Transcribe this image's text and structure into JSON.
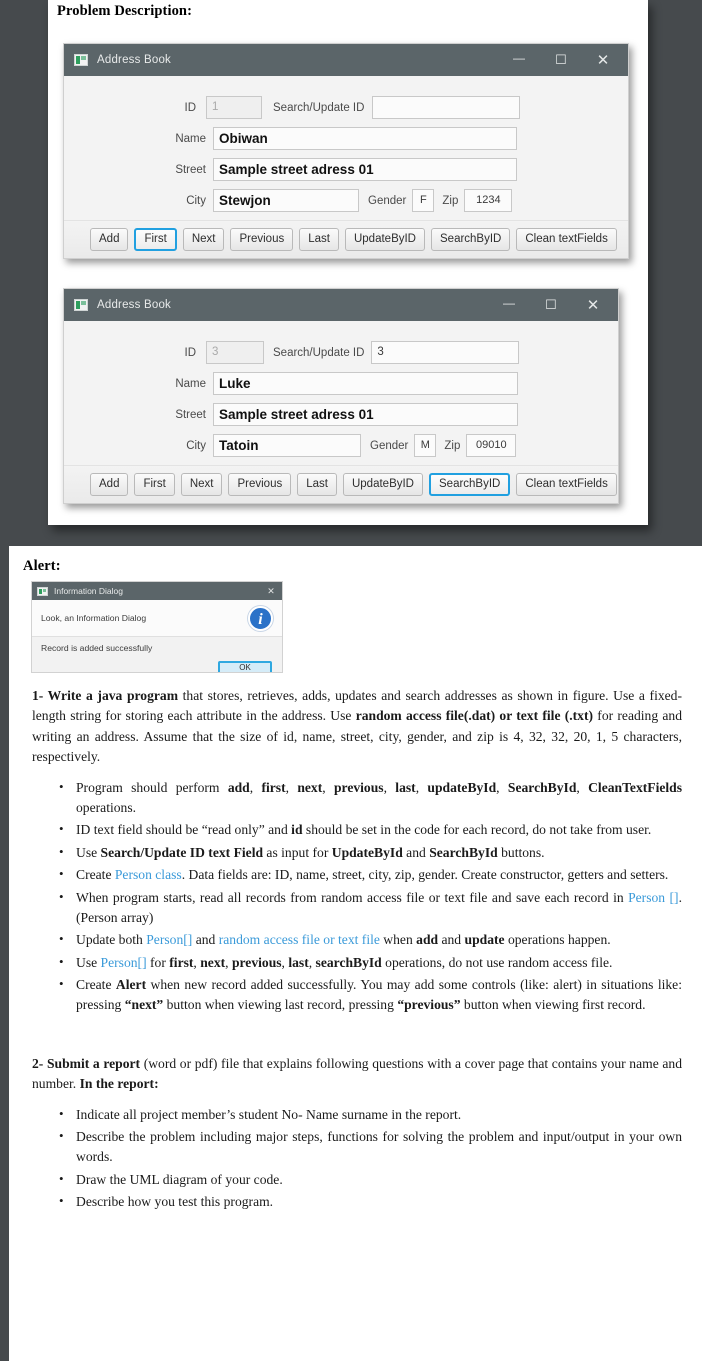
{
  "page": {
    "background_color": "#464a4d",
    "paper_color": "#ffffff"
  },
  "sections": {
    "problem_heading": "Problem Description:",
    "alert_heading": "Alert:"
  },
  "windows": [
    {
      "title": "Address Book",
      "icon": "app-window-icon",
      "titlebar_color": "#5b6569",
      "controls": {
        "minimize": "—",
        "maximize": "☐",
        "close": "✕"
      },
      "fields": {
        "id_label": "ID",
        "id_value": "1",
        "id_readonly": true,
        "search_update_label": "Search/Update ID",
        "search_update_value": "",
        "name_label": "Name",
        "name_value": "Obiwan",
        "street_label": "Street",
        "street_value": "Sample street adress 01",
        "city_label": "City",
        "city_value": "Stewjon",
        "gender_label": "Gender",
        "gender_value": "F",
        "zip_label": "Zip",
        "zip_value": "1234"
      },
      "buttons": [
        {
          "label": "Add",
          "focused": false
        },
        {
          "label": "First",
          "focused": true
        },
        {
          "label": "Next",
          "focused": false
        },
        {
          "label": "Previous",
          "focused": false
        },
        {
          "label": "Last",
          "focused": false
        },
        {
          "label": "UpdateByID",
          "focused": false
        },
        {
          "label": "SearchByID",
          "focused": false
        },
        {
          "label": "Clean textFields",
          "focused": false
        }
      ]
    },
    {
      "title": "Address Book",
      "icon": "app-window-icon",
      "titlebar_color": "#5b6569",
      "controls": {
        "minimize": "—",
        "maximize": "☐",
        "close": "✕"
      },
      "fields": {
        "id_label": "ID",
        "id_value": "3",
        "id_readonly": true,
        "search_update_label": "Search/Update ID",
        "search_update_value": "3",
        "name_label": "Name",
        "name_value": "Luke",
        "street_label": "Street",
        "street_value": "Sample street adress 01",
        "city_label": "City",
        "city_value": "Tatoin",
        "gender_label": "Gender",
        "gender_value": "M",
        "zip_label": "Zip",
        "zip_value": "09010"
      },
      "buttons": [
        {
          "label": "Add",
          "focused": false
        },
        {
          "label": "First",
          "focused": false
        },
        {
          "label": "Next",
          "focused": false
        },
        {
          "label": "Previous",
          "focused": false
        },
        {
          "label": "Last",
          "focused": false
        },
        {
          "label": "UpdateByID",
          "focused": false
        },
        {
          "label": "SearchByID",
          "focused": true
        },
        {
          "label": "Clean textFields",
          "focused": false
        }
      ]
    }
  ],
  "dialog": {
    "title": "Information Dialog",
    "close_glyph": "✕",
    "header_text": "Look, an Information Dialog",
    "icon_glyph": "i",
    "icon_color": "#2b72c8",
    "message": "Record is added successfully",
    "ok_label": "OK",
    "ok_accent": "#2fa8e0"
  },
  "document": {
    "task1": {
      "number_bold": "1- Write a java program",
      "text_a": " that stores, retrieves, adds, updates and search addresses as shown in figure. Use a fixed-length string for storing each attribute in the address. Use ",
      "bold_b": "random access file(.dat) or text file (.txt)",
      "text_c": " for reading and writing an address. Assume that the size of id, name, street, city, gender, and zip is 4, 32, 32, 20, 1, 5 characters, respectively.",
      "bullets": [
        {
          "parts": [
            {
              "t": "Program should perform ",
              "s": "normal"
            },
            {
              "t": "add",
              "s": "bold"
            },
            {
              "t": ", ",
              "s": "normal"
            },
            {
              "t": "first",
              "s": "bold"
            },
            {
              "t": ", ",
              "s": "normal"
            },
            {
              "t": "next",
              "s": "bold"
            },
            {
              "t": ", ",
              "s": "normal"
            },
            {
              "t": "previous",
              "s": "bold"
            },
            {
              "t": ", ",
              "s": "normal"
            },
            {
              "t": "last",
              "s": "bold"
            },
            {
              "t": ", ",
              "s": "normal"
            },
            {
              "t": "updateById",
              "s": "bold"
            },
            {
              "t": ", ",
              "s": "normal"
            },
            {
              "t": "SearchById",
              "s": "bold"
            },
            {
              "t": ", ",
              "s": "normal"
            },
            {
              "t": "CleanTextFields",
              "s": "bold"
            },
            {
              "t": " operations.",
              "s": "normal"
            }
          ]
        },
        {
          "parts": [
            {
              "t": "ID text field should be “read only” and ",
              "s": "normal"
            },
            {
              "t": "id",
              "s": "bold"
            },
            {
              "t": " should be set in the code for each record, do not take from user.",
              "s": "normal"
            }
          ]
        },
        {
          "parts": [
            {
              "t": "Use ",
              "s": "normal"
            },
            {
              "t": "Search/Update ID text Field",
              "s": "bold"
            },
            {
              "t": " as input for ",
              "s": "normal"
            },
            {
              "t": "UpdateById",
              "s": "bold"
            },
            {
              "t": " and ",
              "s": "normal"
            },
            {
              "t": "SearchById",
              "s": "bold"
            },
            {
              "t": " buttons.",
              "s": "normal"
            }
          ]
        },
        {
          "parts": [
            {
              "t": "Create ",
              "s": "normal"
            },
            {
              "t": "Person class",
              "s": "blue"
            },
            {
              "t": ". Data fields are: ID, name, street, city, zip, gender. Create constructor, getters and setters.",
              "s": "normal"
            }
          ]
        },
        {
          "parts": [
            {
              "t": "When program starts, read all records from random access file or text file and save each record in ",
              "s": "normal"
            },
            {
              "t": "Person []",
              "s": "blue"
            },
            {
              "t": ". (Person array)",
              "s": "normal"
            }
          ]
        },
        {
          "parts": [
            {
              "t": "Update both ",
              "s": "normal"
            },
            {
              "t": "Person[]",
              "s": "blue"
            },
            {
              "t": " and ",
              "s": "normal"
            },
            {
              "t": "random access file or text file",
              "s": "blue"
            },
            {
              "t": " when ",
              "s": "normal"
            },
            {
              "t": "add",
              "s": "bold"
            },
            {
              "t": " and ",
              "s": "normal"
            },
            {
              "t": "update",
              "s": "bold"
            },
            {
              "t": " operations happen.",
              "s": "normal"
            }
          ]
        },
        {
          "parts": [
            {
              "t": "Use ",
              "s": "normal"
            },
            {
              "t": "Person[]",
              "s": "blue"
            },
            {
              "t": " for ",
              "s": "normal"
            },
            {
              "t": "first",
              "s": "bold"
            },
            {
              "t": ", ",
              "s": "normal"
            },
            {
              "t": "next",
              "s": "bold"
            },
            {
              "t": ", ",
              "s": "normal"
            },
            {
              "t": "previous",
              "s": "bold"
            },
            {
              "t": ", ",
              "s": "normal"
            },
            {
              "t": "last",
              "s": "bold"
            },
            {
              "t": ", ",
              "s": "normal"
            },
            {
              "t": "searchById",
              "s": "bold"
            },
            {
              "t": " operations, do not use random access file.",
              "s": "normal"
            }
          ]
        },
        {
          "parts": [
            {
              "t": "Create ",
              "s": "normal"
            },
            {
              "t": "Alert",
              "s": "bold"
            },
            {
              "t": " when new record added successfully. You may add some controls (like: alert) in situations like: pressing ",
              "s": "normal"
            },
            {
              "t": "“next”",
              "s": "bold"
            },
            {
              "t": " button when viewing last record, pressing ",
              "s": "normal"
            },
            {
              "t": "“previous”",
              "s": "bold"
            },
            {
              "t": " button when viewing first record.",
              "s": "normal"
            }
          ]
        }
      ]
    },
    "task2": {
      "number_bold": "2- Submit a report",
      "text_a": " (word or pdf) file that explains following questions with a cover page that contains your name and number. ",
      "bold_b": "In the report:",
      "bullets": [
        {
          "parts": [
            {
              "t": "Indicate all project member’s student No- Name surname in the report.",
              "s": "normal"
            }
          ]
        },
        {
          "parts": [
            {
              "t": "Describe the problem including major steps, functions for solving the problem and input/output in your own words.",
              "s": "normal"
            }
          ]
        },
        {
          "parts": [
            {
              "t": "Draw the UML diagram of your code.",
              "s": "normal"
            }
          ]
        },
        {
          "parts": [
            {
              "t": "Describe how you test this program.",
              "s": "normal"
            }
          ]
        }
      ]
    }
  }
}
